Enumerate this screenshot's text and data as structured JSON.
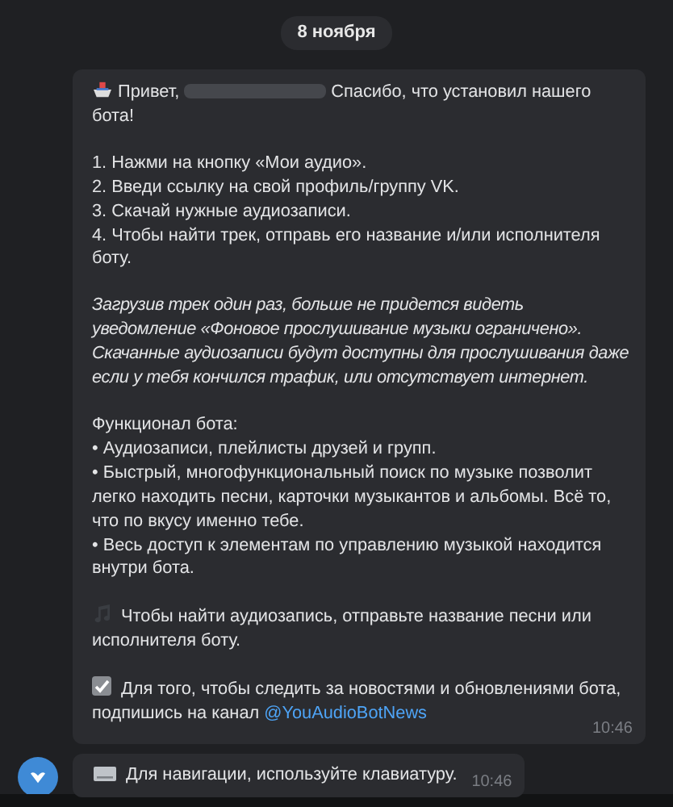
{
  "date": "8 ноября",
  "messages": [
    {
      "kind": "bot",
      "time": "10:46",
      "blocks": [
        {
          "kind": "greeting",
          "lines": [
            "Привет,",
            "Спасибо, что установил нашего бота!"
          ]
        },
        {
          "kind": "plain",
          "lines": [
            "1. Нажми на кнопку «Мои аудио».",
            "2. Введи ссылку на свой профиль/группу VK.",
            "3. Скачай нужные аудиозаписи.",
            "4. Чтобы найти трек, отправь его название и/или исполнителя боту."
          ]
        },
        {
          "kind": "italic",
          "lines": [
            "Загрузив трек один раз, больше не придется видеть уведомление «Фоновое прослушивание музыки ограничено». Скачанные аудиозаписи будут доступны для прослушивания даже если у тебя кончился трафик, или отсутствует интернет."
          ]
        },
        {
          "kind": "plain",
          "lines": [
            "Функционал бота:",
            "• Аудиозаписи, плейлисты друзей и групп.",
            "• Быстрый, многофункциональный поиск по музыке позволит легко находить песни, карточки музыкантов и альбомы. Всё то, что по вкусу именно тебе.",
            "• Весь доступ к элементам по управлению музыкой находится внутри бота."
          ]
        },
        {
          "kind": "music",
          "lines": [
            "Чтобы найти аудиозапись, отправьте название песни или исполнителя боту."
          ]
        },
        {
          "kind": "check",
          "lines": [
            "Для того, чтобы следить за новостями и обновлениями бота, подпишись на канал"
          ],
          "link": "@YouAudioBotNews"
        }
      ]
    },
    {
      "kind": "keyboard",
      "time": "10:46",
      "blocks": [
        {
          "kind": "keyboard",
          "lines": [
            "Для навигации, используйте клавиатуру."
          ]
        }
      ]
    }
  ]
}
